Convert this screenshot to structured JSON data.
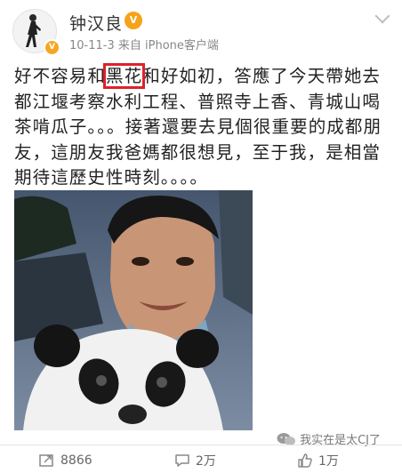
{
  "post": {
    "username": "钟汉良",
    "vip_badge": "V",
    "meta": "10-11-3  来自 iPhone客户端",
    "text_before": "好不容易和",
    "text_highlight": "黑花",
    "text_after": "和好如初，答應了今天帶她去都江堰考察水利工程、普照寺上香、青城山喝茶啃瓜子。。。接著還要去見個很重要的成都朋友，這朋友我爸媽都很想見，至于我，是相當期待這歷史性時刻。。。。"
  },
  "actions": {
    "repost_count": "8866",
    "comment_count": "2万",
    "like_count": "1万"
  },
  "watermark": "我实在是太CJ了",
  "colors": {
    "highlight_border": "#e0202a",
    "vip_badge": "#f7a21b",
    "meta_gray": "#888888"
  }
}
